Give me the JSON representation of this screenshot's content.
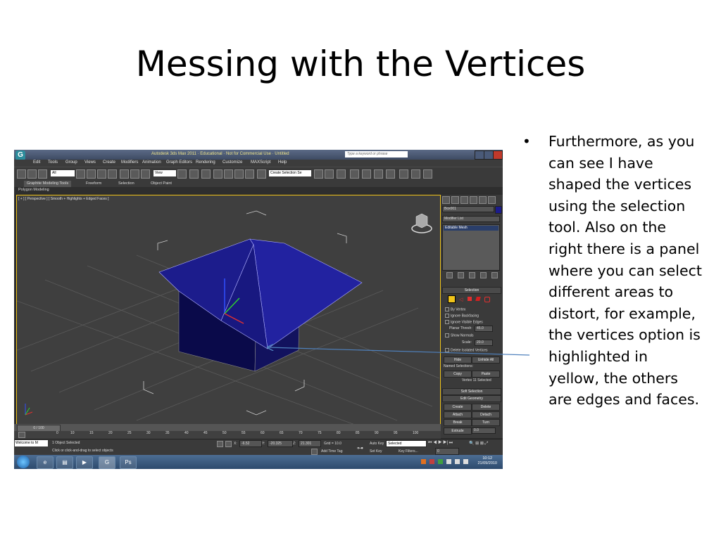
{
  "slide": {
    "title": "Messing with the Vertices",
    "bullet_marker": "•",
    "bullet_text": "Furthermore, as you can see I have shaped the vertices using the selection tool. Also on the right there is a panel where you can select different areas to distort, for example, the vertices option is highlighted in yellow, the others are edges and faces."
  },
  "app": {
    "title": "Autodesk 3ds Max 2011 · Educational · Not for Commercial Use · Untitled",
    "search_placeholder": "Type a keyword or phrase",
    "menu": [
      "Edit",
      "Tools",
      "Group",
      "Views",
      "Create",
      "Modifiers",
      "Animation",
      "Graph Editors",
      "Rendering",
      "Customize",
      "MAXScript",
      "Help"
    ],
    "toolbar": {
      "filter_value": "All",
      "view_value": "View",
      "selection_set": "Create Selection Se"
    },
    "ribbon_tabs": [
      "Graphite Modeling Tools",
      "Freeform",
      "Selection",
      "Object Paint"
    ],
    "subtab": "Polygon Modeling",
    "viewport_label": "[ + ] [ Perspective ] [ Smooth + Highlights + Edged Faces ]",
    "command_panel": {
      "object_name": "Box001",
      "modifier_list": "Modifier List",
      "stack_item": "Editable Mesh",
      "selection_title": "Selection",
      "by_vertex": "By Vertex",
      "ignore_backfacing": "Ignore Backfacing",
      "ignore_visible_edges": "Ignore Visible Edges",
      "planar_thresh": "Planar Thresh:",
      "planar_value": "45.0",
      "show_normals": "Show Normals",
      "scale_label": "Scale:",
      "scale_value": "20.0",
      "delete_isolated": "Delete Isolated Vertices",
      "hide": "Hide",
      "unhide_all": "Unhide All",
      "named_selections": "Named Selections:",
      "copy": "Copy",
      "paste": "Paste",
      "vertex_selected": "Vertex 11 Selected",
      "soft_selection": "Soft Selection",
      "edit_geometry": "Edit Geometry",
      "create": "Create",
      "delete": "Delete",
      "attach": "Attach",
      "detach": "Detach",
      "break": "Break",
      "turn": "Turn",
      "extrude": "Extrude",
      "extrude_value": "0.0"
    },
    "timeline": {
      "position": "0 / 100"
    },
    "ruler_ticks": [
      "0",
      "10",
      "15",
      "20",
      "25",
      "30",
      "35",
      "40",
      "45",
      "50",
      "55",
      "60",
      "65",
      "70",
      "75",
      "80",
      "85",
      "90",
      "95",
      "100"
    ],
    "status": {
      "listener": "Welcome to M",
      "selected": "1 Object Selected",
      "prompt": "Click or click-and-drag to select objects",
      "x_label": "X:",
      "x_value": "-6.52",
      "y_label": "Y:",
      "y_value": "-20.325",
      "z_label": "Z:",
      "z_value": "21.301",
      "grid": "Grid = 10.0",
      "add_time_tag": "Add Time Tag",
      "auto_key": "Auto Key",
      "auto_key_value": "Selected",
      "set_key": "Set Key",
      "key_filters": "Key Filters...",
      "frame": "0"
    },
    "taskbar": {
      "time": "10:12",
      "date": "21/09/2010"
    },
    "colors": {
      "selection_highlight": "#f0c419",
      "mesh": "#1c1c8c"
    }
  }
}
